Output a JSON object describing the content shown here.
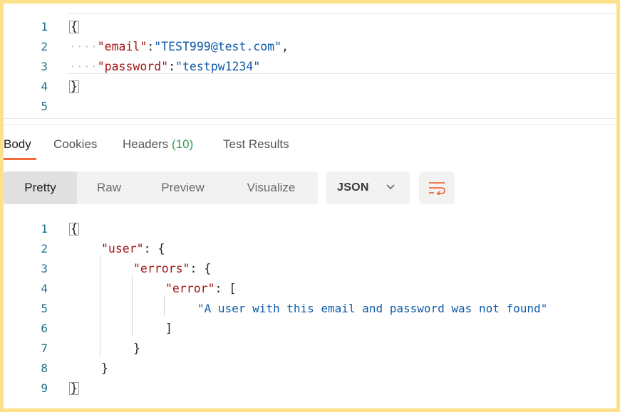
{
  "request_editor": {
    "line_numbers": [
      "1",
      "2",
      "3",
      "4",
      "5"
    ],
    "open_brace": "{",
    "close_brace": "}",
    "indent_dots": "····",
    "email_key": "\"email\"",
    "email_value": "\"TEST999@test.com\"",
    "password_key": "\"password\"",
    "password_value": "\"testpw1234\"",
    "colon": ":",
    "comma": ","
  },
  "response_tabs": {
    "body": "Body",
    "cookies": "Cookies",
    "headers": "Headers",
    "headers_count": "(10)",
    "test_results": "Test Results"
  },
  "view_modes": {
    "pretty": "Pretty",
    "raw": "Raw",
    "preview": "Preview",
    "visualize": "Visualize",
    "selected": "Pretty"
  },
  "format_select": {
    "value": "JSON",
    "icon": "chevron-down-icon"
  },
  "wrap_button": {
    "icon": "wrap-lines-icon",
    "accent": "#f26b3a"
  },
  "response_body": {
    "line_numbers": [
      "1",
      "2",
      "3",
      "4",
      "5",
      "6",
      "7",
      "8",
      "9"
    ],
    "open_brace": "{",
    "close_brace": "}",
    "user_key": "\"user\"",
    "errors_key": "\"errors\"",
    "error_key": "\"error\"",
    "colon_brace": ": {",
    "colon_bracket": ": [",
    "message": "\"A user with this email and password was not found\"",
    "close_bracket": "]"
  },
  "colors": {
    "frame": "#fce18a",
    "key": "#a31515",
    "string": "#0f5ba8",
    "line_number": "#1f6f8b",
    "active_tab": "#f26b3a",
    "count": "#2e9e4e"
  }
}
